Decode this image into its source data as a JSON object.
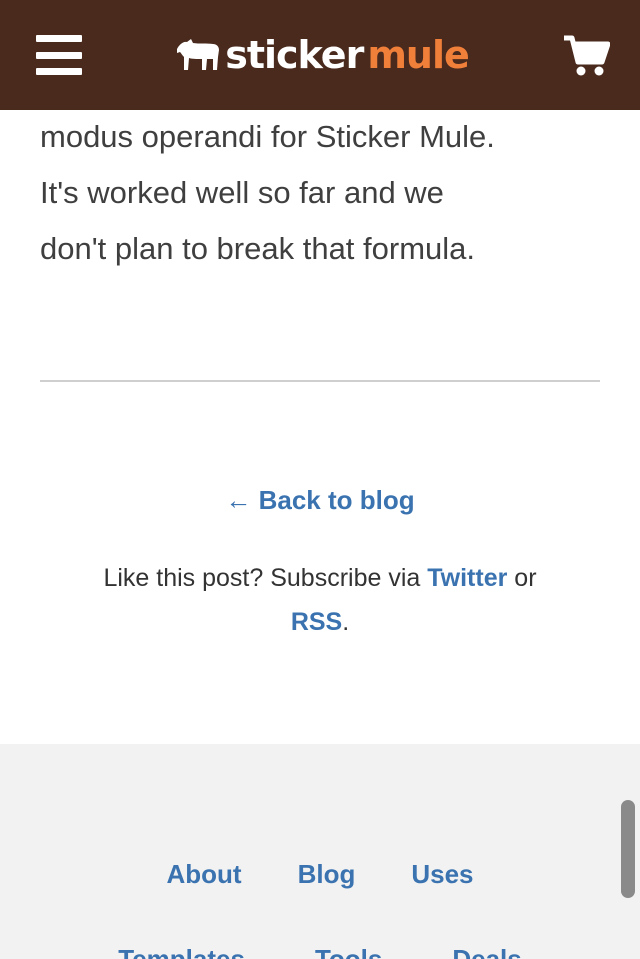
{
  "header": {
    "menu_icon": "hamburger-menu-icon",
    "logo_icon": "mule-icon",
    "logo_part1": "sticker",
    "logo_part2": "mule",
    "cart_icon": "shopping-cart-icon",
    "colors": {
      "bar": "#4a2a1d",
      "accent": "#f07f3a"
    }
  },
  "article": {
    "lines": [
      "modus operandi for Sticker Mule.",
      "It's worked well so far and we",
      "don't plan to break that formula."
    ]
  },
  "post_nav": {
    "back_label": "← Back to blog",
    "subscribe_prefix": "Like this post? Subscribe via ",
    "twitter_label": "Twitter",
    "subscribe_or": " or",
    "rss_label": "RSS",
    "subscribe_end": "."
  },
  "footer": {
    "links": [
      "About",
      "Blog",
      "Uses"
    ],
    "links_partial": [
      "Templates",
      "Tools",
      "Deals"
    ]
  }
}
